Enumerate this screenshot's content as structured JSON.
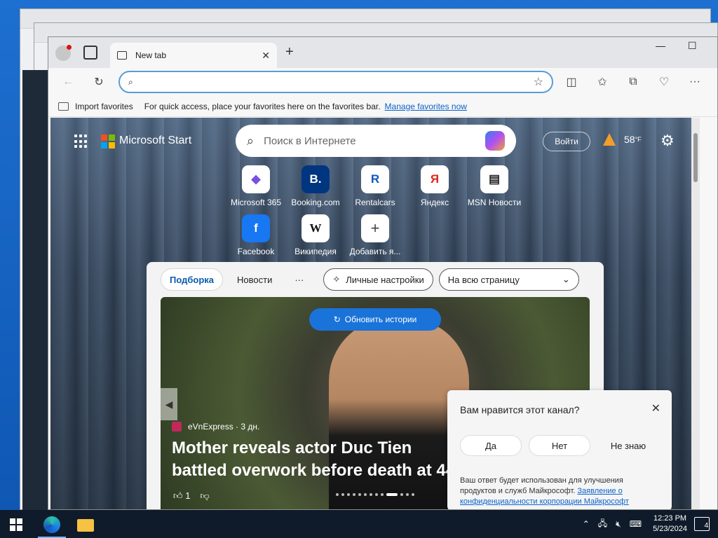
{
  "browser": {
    "tab_title": "New tab",
    "address_placeholder": "",
    "favorites_bar": {
      "import_label": "Import favorites",
      "tip": "For quick access, place your favorites here on the favorites bar.",
      "manage_link": "Manage favorites now"
    }
  },
  "start_page": {
    "brand": "Microsoft Start",
    "search_placeholder": "Поиск в Интернете",
    "login_label": "Войти",
    "weather_temp": "58",
    "weather_unit": "°F",
    "quick_links": [
      {
        "label": "Microsoft 365",
        "icon": "microsoft-365-icon",
        "glyph": "◆"
      },
      {
        "label": "Booking.com",
        "icon": "booking-icon",
        "glyph": "B."
      },
      {
        "label": "Rentalcars",
        "icon": "rentalcars-icon",
        "glyph": "R"
      },
      {
        "label": "Яндекс",
        "icon": "yandex-icon",
        "glyph": "Я"
      },
      {
        "label": "MSN Новости",
        "icon": "msn-news-icon",
        "glyph": "▤"
      },
      {
        "label": "Facebook",
        "icon": "facebook-icon",
        "glyph": "f"
      },
      {
        "label": "Википедия",
        "icon": "wikipedia-icon",
        "glyph": "W"
      },
      {
        "label": "Добавить я...",
        "icon": "add-shortcut-icon",
        "glyph": "+"
      }
    ],
    "feed": {
      "tabs": [
        "Подборка",
        "Новости",
        "···"
      ],
      "personalize_label": "Личные настройки",
      "layout_label": "На всю страницу",
      "refresh_label": "Обновить истории",
      "story": {
        "source": "eVnExpress · 3 дн.",
        "headline": "Mother reveals actor Duc Tien battled overwork before death at 44",
        "likes": "1"
      }
    },
    "survey": {
      "question": "Вам нравится этот канал?",
      "yes": "Да",
      "no": "Нет",
      "dont_know": "Не знаю",
      "note": "Ваш ответ будет использован для улучшения продуктов и служб Майкрософт.",
      "privacy_link": "Заявление о конфиденциальности корпорации Майкрософт"
    }
  },
  "taskbar": {
    "time": "12:23 PM",
    "date": "5/23/2024",
    "notifications": "4"
  }
}
